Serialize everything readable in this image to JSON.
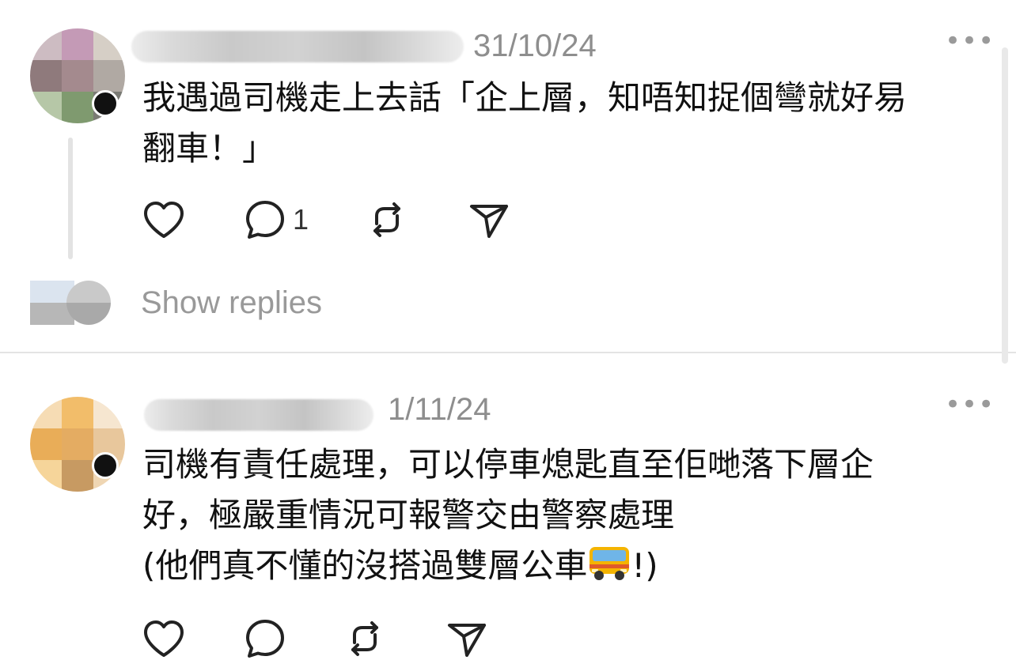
{
  "posts": [
    {
      "timestamp": "31/10/24",
      "more_icon": "more-horizontal-icon",
      "text_lines": [
        "我遇過司機走上去話「企上層，知唔知捉個彎就好易",
        "翻車！」"
      ],
      "reply_count": "1",
      "show_replies_label": "Show replies"
    },
    {
      "timestamp": "1/11/24",
      "more_icon": "more-horizontal-icon",
      "text_lines": [
        "司機有責任處理，可以停車熄匙直至佢哋落下層企",
        "好，極嚴重情況可報警交由警察處理"
      ],
      "third_line_text": "(他們真不懂的沒搭過雙層公車",
      "third_line_end": "!)",
      "emoji": "bus-icon"
    }
  ],
  "icons": {
    "like": "heart-icon",
    "reply": "comment-icon",
    "repost": "repost-icon",
    "share": "send-icon"
  }
}
